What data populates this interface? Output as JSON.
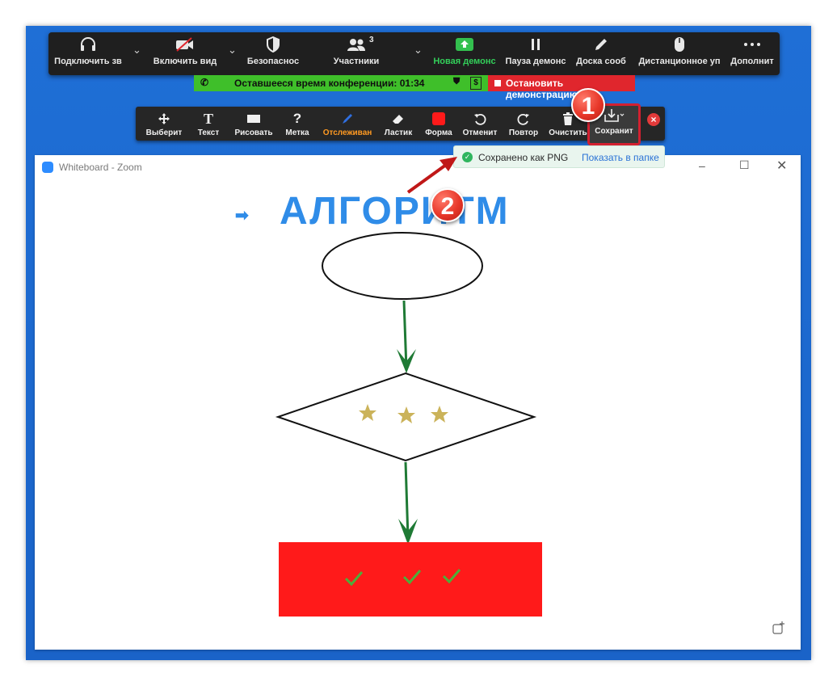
{
  "meeting_bar": {
    "audio_label": "Подключить зв",
    "video_label": "Включить вид",
    "security_label": "Безопаснос",
    "participants_label": "Участники",
    "participants_count": "3",
    "share_label": "Новая демонс",
    "pause_label": "Пауза демонс",
    "board_label": "Доска сооб",
    "remote_label": "Дистанционное уп",
    "more_label": "Дополнит"
  },
  "status": {
    "remaining_label": "Оставшееся время конференции: 01:34",
    "dollar_icon_text": "$",
    "stop_label": "Остановить демонстрацию"
  },
  "whiteboard_toolbar": {
    "select_label": "Выберит",
    "text_label": "Текст",
    "draw_label": "Рисовать",
    "stamp_label": "Метка",
    "spotlight_label": "Отслеживан",
    "eraser_label": "Ластик",
    "format_label": "Форма",
    "undo_label": "Отменит",
    "redo_label": "Повтор",
    "clear_label": "Очистить",
    "save_label": "Сохранит",
    "text_icon_glyph": "T",
    "stamp_icon_glyph": "?"
  },
  "toast": {
    "message": "Сохранено как PNG",
    "link": "Показать в папке"
  },
  "window": {
    "title": "Whiteboard - Zoom"
  },
  "canvas": {
    "heading": "АЛГОРИТМ",
    "arrow_glyph": "➡",
    "colors": {
      "heading": "#2f8ce8",
      "connector": "#1f7a35",
      "star": "#cbb35a",
      "box": "#ff1a1a",
      "check": "#4caf3a"
    }
  },
  "annotations": {
    "step1": "1",
    "step2": "2"
  }
}
